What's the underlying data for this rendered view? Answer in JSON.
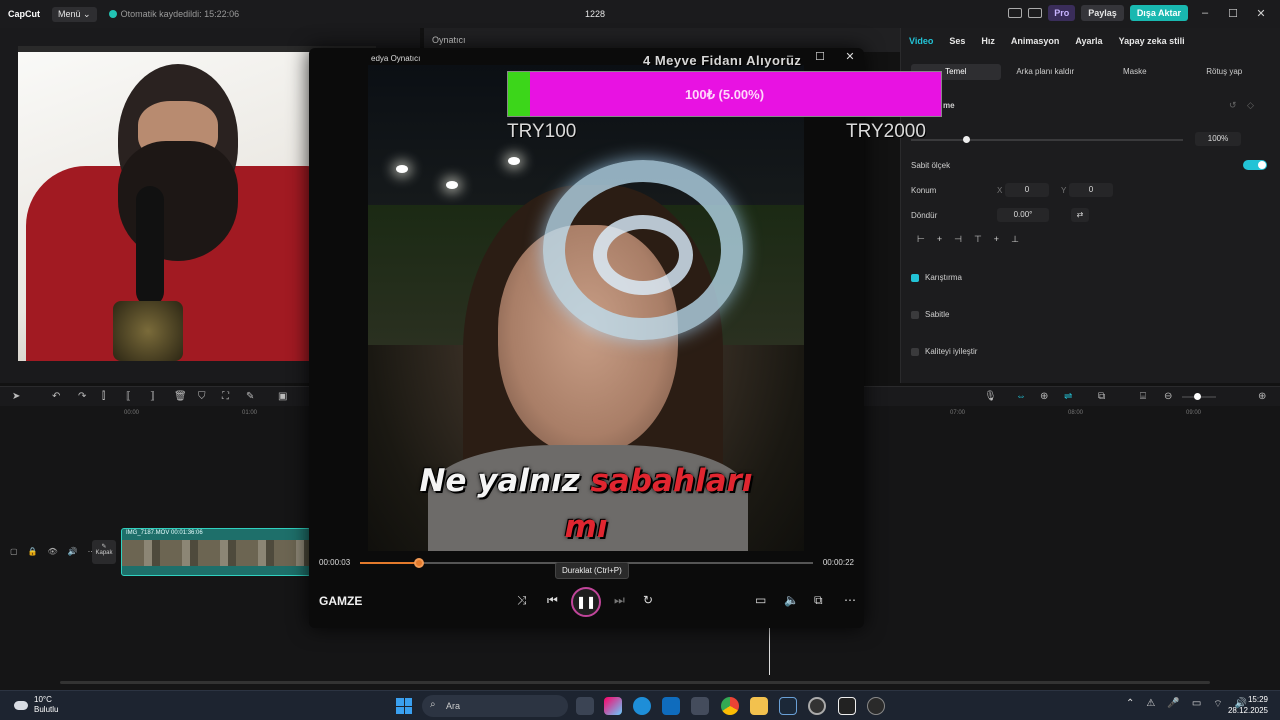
{
  "app": {
    "logo": "CapCut",
    "menu_label": "Menü ⌄",
    "autosave_text": "Otomatik kaydedildi: 15:22:06",
    "project_title": "1228",
    "pro_label": "Pro",
    "share_label": "Paylaş",
    "export_label": "Dışa Aktar",
    "accent_color": "#19b8b0"
  },
  "player_panel": {
    "header": "Oynatıcı"
  },
  "inspector": {
    "tabs": [
      "Video",
      "Ses",
      "Hız",
      "Animasyon",
      "Ayarla",
      "Yapay zeka stili"
    ],
    "subtabs": [
      "Temel",
      "Arka planı kaldır",
      "Maske",
      "Rötuş yap"
    ],
    "transform_label": "me",
    "scale_value": "100%",
    "uniform_scale_label": "Sabit ölçek",
    "position_label": "Konum",
    "pos_x_label": "X",
    "pos_x": "0",
    "pos_y_label": "Y",
    "pos_y": "0",
    "rotate_label": "Döndür",
    "rotate_value": "0.00°",
    "blend_label": "Karıştırma",
    "stabilize_label": "Sabitle",
    "enhance_label": "Kaliteyi iyileştir"
  },
  "timeline": {
    "ruler": [
      "00:00",
      "01:00",
      "07:00",
      "08:00",
      "09:00"
    ],
    "cover_label": "Kapak",
    "clip_label": "IMG_7187.MOV   00:01:36:06"
  },
  "media_player": {
    "title": "edya Oynatıcı",
    "time_current": "00:00:03",
    "time_total": "00:00:22",
    "progress": 0.13,
    "song": "GAMZE",
    "tooltip": "Duraklat (Ctrl+P)",
    "lyric_line1_white": "Ne yalnız ",
    "lyric_line1_red": "sabahları",
    "lyric_line2_red": "mı"
  },
  "stream_overlay": {
    "title": "4 Meyve Fidanı Alıyoruz",
    "goal_text": "100₺ (5.00%)",
    "goal_progress": 0.05,
    "goal_min": "TRY100",
    "goal_max": "TRY2000",
    "bar_color": "#e812e2",
    "fill_color": "#3cd61a"
  },
  "taskbar": {
    "temperature": "10°C",
    "weather": "Bulutlu",
    "search_placeholder": "Ara",
    "time": "15:29",
    "date": "28.12.2025"
  }
}
